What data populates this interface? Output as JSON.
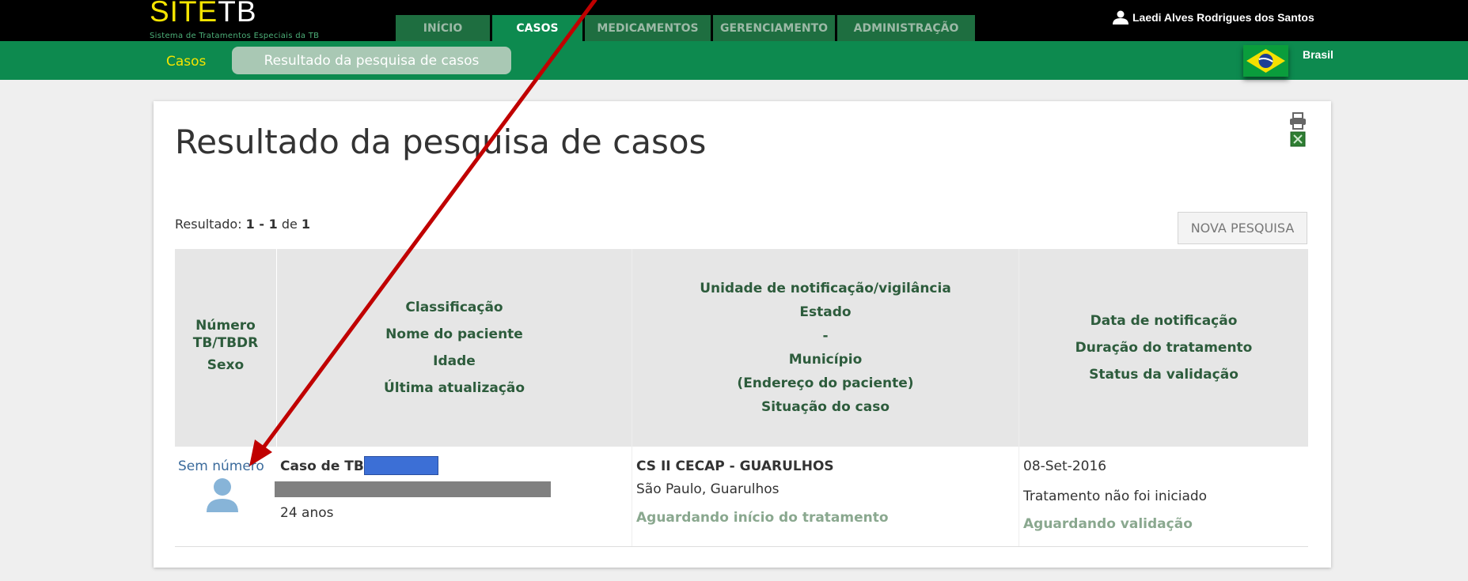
{
  "header": {
    "logo_site": "SITE",
    "logo_tb": "TB",
    "subtitle": "Sistema de Tratamentos Especiais da TB",
    "tabs": [
      {
        "label": "INÍCIO",
        "active": false
      },
      {
        "label": "CASOS",
        "active": true
      },
      {
        "label": "MEDICAMENTOS",
        "active": false
      },
      {
        "label": "GERENCIAMENTO",
        "active": false
      },
      {
        "label": "ADMINISTRAÇÃO",
        "active": false
      }
    ],
    "user_name": "Laedi Alves Rodrigues dos Santos",
    "country": "Brasil"
  },
  "breadcrumb": {
    "home": "Casos",
    "current": "Resultado da pesquisa de casos"
  },
  "main": {
    "title": "Resultado da pesquisa de casos",
    "result_prefix": "Resultado:",
    "result_range": "1 - 1",
    "result_of": "de",
    "result_total": "1",
    "new_search": "NOVA PESQUISA",
    "columns": [
      {
        "lines": [
          "Número TB/TBDR",
          "Sexo"
        ]
      },
      {
        "lines": [
          "Classificação",
          "Nome do paciente",
          "Idade",
          "Última atualização"
        ]
      },
      {
        "lines": [
          "Unidade de notificação/vigilância",
          "Estado",
          "-",
          "Município",
          "(Endereço do paciente)",
          "Situação do caso"
        ]
      },
      {
        "lines": [
          "Data de notificação",
          "Duração do tratamento",
          "Status da validação"
        ]
      }
    ],
    "row": {
      "number": "Sem número",
      "classification": "Caso de TB",
      "age": "24 anos",
      "unit": "CS II CECAP - GUARULHOS",
      "location": "São Paulo, Guarulhos",
      "case_status": "Aguardando início do tratamento",
      "notif_date": "08-Set-2016",
      "duration": "Tratamento não foi iniciado",
      "validation": "Aguardando validação"
    }
  },
  "colors": {
    "topbar": "#000000",
    "subbar": "#0d8a4f",
    "tab_inactive": "#1e6e40",
    "tab_active": "#0d8a4f",
    "header_text": "#2d5c3c",
    "link": "#3b6b9c",
    "annotation_arrow": "#c00000"
  }
}
